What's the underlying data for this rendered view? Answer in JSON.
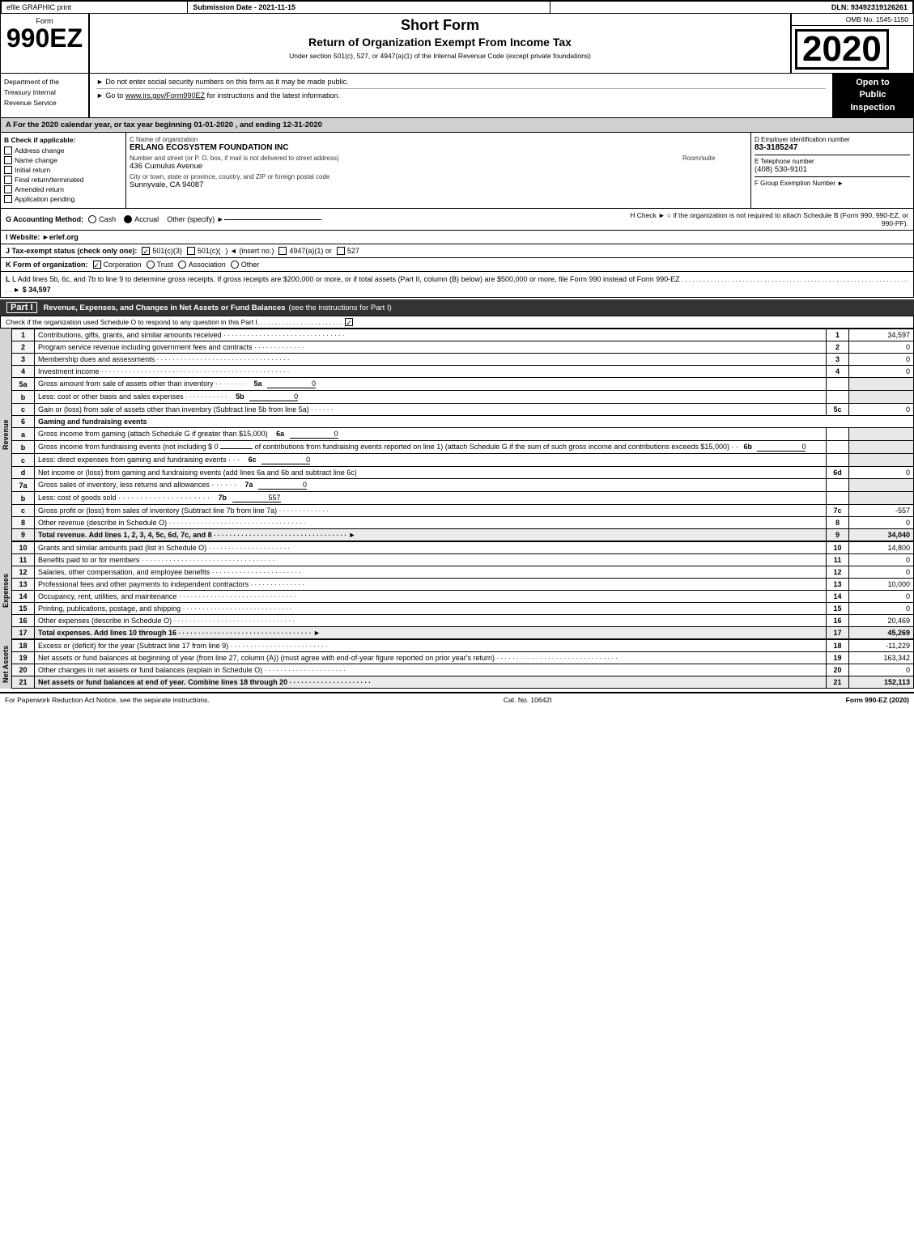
{
  "header": {
    "graphic_print": "efile GRAPHIC print",
    "submission_date_label": "Submission Date - 2021-11-15",
    "dln_label": "DLN: 93492319126261",
    "form_label": "Form",
    "form_number": "990EZ",
    "short_form": "Short Form",
    "return_title": "Return of Organization Exempt From Income Tax",
    "subtitle": "Under section 501(c), 527, or 4947(a)(1) of the Internal Revenue Code (except private foundations)",
    "do_not_enter": "► Do not enter social security numbers on this form as it may be made public.",
    "go_to": "► Go to www.irs.gov/Form990EZ for instructions and the latest information.",
    "year": "2020",
    "omb": "OMB No. 1545-1150",
    "open_to_public": "Open to\nPublic\nInspection"
  },
  "dept": {
    "name": "Department of the Treasury Internal Revenue Service"
  },
  "section_a": {
    "label": "A For the 2020 calendar year, or tax year beginning 01-01-2020 , and ending 12-31-2020"
  },
  "check_if": {
    "label": "B Check if applicable:",
    "items": [
      {
        "id": "address",
        "label": "Address change",
        "checked": false
      },
      {
        "id": "name",
        "label": "Name change",
        "checked": false
      },
      {
        "id": "initial",
        "label": "Initial return",
        "checked": false
      },
      {
        "id": "final",
        "label": "Final return/terminated",
        "checked": false
      },
      {
        "id": "amended",
        "label": "Amended return",
        "checked": false
      },
      {
        "id": "app_pending",
        "label": "Application pending",
        "checked": false
      }
    ]
  },
  "org": {
    "name_label": "C Name of organization",
    "name": "ERLANG ECOSYSTEM FOUNDATION INC",
    "address_label": "Number and street (or P. O. box, if mail is not delivered to street address)",
    "address": "436 Cumulus Avenue",
    "room_label": "Room/suite",
    "room": "",
    "city_label": "City or town, state or province, country, and ZIP or foreign postal code",
    "city": "Sunnyvale, CA 94087",
    "ein_label": "D Employer identification number",
    "ein": "83-3185247",
    "phone_label": "E Telephone number",
    "phone": "(408) 530-9101",
    "group_label": "F Group Exemption Number",
    "group_arrow": "►",
    "group_num": ""
  },
  "accounting": {
    "g_label": "G Accounting Method:",
    "cash_label": "Cash",
    "accrual_label": "Accrual",
    "accrual_checked": true,
    "other_label": "Other (specify) ►",
    "h_label": "H Check ► ○ if the organization is not required to attach Schedule B (Form 990, 990-EZ, or 990-PF)."
  },
  "website": {
    "i_label": "I Website: ►erlef.org"
  },
  "tax_exempt": {
    "j_label": "J Tax-exempt status (check only one):",
    "options": [
      {
        "label": "501(c)(3)",
        "checked": true
      },
      {
        "label": "501(c)(",
        "checked": false
      },
      {
        "label": ") ◄ (insert no.)",
        "checked": false
      },
      {
        "label": "4947(a)(1) or",
        "checked": false
      },
      {
        "label": "527",
        "checked": false
      }
    ]
  },
  "k_form": {
    "label": "K Form of organization:",
    "options": [
      {
        "label": "Corporation",
        "checked": true
      },
      {
        "label": "Trust",
        "checked": false
      },
      {
        "label": "Association",
        "checked": false
      },
      {
        "label": "Other",
        "checked": false
      }
    ]
  },
  "l_row": {
    "text": "L Add lines 5b, 6c, and 7b to line 9 to determine gross receipts. If gross receipts are $200,000 or more, or if total assets (Part II, column (B) below) are $500,000 or more, file Form 990 instead of Form 990-EZ",
    "dots": ". . . . . . . . . . . . . . . . . . . . . . . . . . . . . . . . . . . . . . . . . . . . . . . . . . . . . . . . . . . . . . . . .",
    "arrow": "►",
    "value": "$ 34,597"
  },
  "part1": {
    "label": "Part I",
    "title": "Revenue, Expenses, and Changes in Net Assets or Fund Balances",
    "see_instructions": "(see the instructions for Part I)",
    "check_text": "Check if the organization used Schedule O to respond to any question in this Part I",
    "dots": ". . . . . . . . . . . . . . . . . . . . . . . .",
    "check_box": true
  },
  "revenue_rows": [
    {
      "num": "1",
      "desc": "Contributions, gifts, grants, and similar amounts received",
      "dots": "· · · · · · · · · · · · · · · · · · · · · · · · · · · · · · ·",
      "line_num": "1",
      "value": "34,597"
    },
    {
      "num": "2",
      "desc": "Program service revenue including government fees and contracts",
      "dots": "· · · · · · · · · · · · ·",
      "line_num": "2",
      "value": "0"
    },
    {
      "num": "3",
      "desc": "Membership dues and assessments",
      "dots": "· · · · · · · · · · · · · · · · · · · · · · · · · · · · · · · · · ·",
      "line_num": "3",
      "value": "0"
    },
    {
      "num": "4",
      "desc": "Investment income",
      "dots": "· · · · · · · · · · · · · · · · · · · · · · · · · · · · · · · · · · · · · · · · · · · · · · · ·",
      "line_num": "4",
      "value": "0"
    }
  ],
  "row_5a": {
    "num": "5a",
    "desc": "Gross amount from sale of assets other than inventory",
    "dots": "· · · · · · · ·",
    "sub_line": "5a",
    "sub_value": "0"
  },
  "row_5b": {
    "letter": "b",
    "desc": "Less: cost or other basis and sales expenses",
    "dots": "· · · · · · · · · · ·",
    "sub_line": "5b",
    "sub_value": "0"
  },
  "row_5c": {
    "letter": "c",
    "desc": "Gain or (loss) from sale of assets other than inventory (Subtract line 5b from line 5a)",
    "dots": "· · · · · ·",
    "line_num": "5c",
    "value": "0"
  },
  "row_6": {
    "num": "6",
    "desc": "Gaming and fundraising events"
  },
  "row_6a": {
    "letter": "a",
    "desc": "Gross income from gaming (attach Schedule G if greater than $15,000)",
    "sub_line": "6a",
    "sub_value": "0"
  },
  "row_6b": {
    "letter": "b",
    "desc": "Gross income from fundraising events (not including $ 0 of contributions from fundraising events reported on line 1) (attach Schedule G if the sum of such gross income and contributions exceeds $15,000)",
    "dots": "· ·",
    "sub_line": "6b",
    "sub_value": "0"
  },
  "row_6c": {
    "letter": "c",
    "desc": "Less: direct expenses from gaming and fundraising events",
    "dots": "· · ·",
    "sub_line": "6c",
    "sub_value": "0"
  },
  "row_6d": {
    "letter": "d",
    "desc": "Net income or (loss) from gaming and fundraising events (add lines 6a and 6b and subtract line 6c)",
    "line_num": "6d",
    "value": "0"
  },
  "row_7a": {
    "num": "7a",
    "desc": "Gross sales of inventory, less returns and allowances",
    "dots": "· · · · · ·",
    "sub_line": "7a",
    "sub_value": "0"
  },
  "row_7b": {
    "letter": "b",
    "desc": "Less: cost of goods sold",
    "dots": "· · · · · · · · · · · · · · · · · · · · ·",
    "sub_line": "7b",
    "sub_value": "557"
  },
  "row_7c": {
    "letter": "c",
    "desc": "Gross profit or (loss) from sales of inventory (Subtract line 7b from line 7a)",
    "dots": "· · · · · · · · · · · · ·",
    "line_num": "7c",
    "value": "-557"
  },
  "row_8": {
    "num": "8",
    "desc": "Other revenue (describe in Schedule O)",
    "dots": "· · · · · · · · · · · · · · · · · · · · · · · · · · · · · · · · · · ·",
    "line_num": "8",
    "value": "0"
  },
  "row_9": {
    "num": "9",
    "desc": "Total revenue. Add lines 1, 2, 3, 4, 5c, 6d, 7c, and 8",
    "dots": "· · · · · · · · · · · · · · · · · · · · · · · · · · · · · · · · · ·",
    "arrow": "►",
    "line_num": "9",
    "value": "34,040",
    "bold": true
  },
  "expense_rows": [
    {
      "num": "10",
      "desc": "Grants and similar amounts paid (list in Schedule O)",
      "dots": "· · · · · · · · · · · · · · · · · · · · ·",
      "line_num": "10",
      "value": "14,800"
    },
    {
      "num": "11",
      "desc": "Benefits paid to or for members",
      "dots": "· · · · · · · · · · · · · · · · · · · · · · · · · · · · · · · · · ·",
      "line_num": "11",
      "value": "0"
    },
    {
      "num": "12",
      "desc": "Salaries, other compensation, and employee benefits",
      "dots": "· · · · · · · · · · · · · · · · · · · · · · ·",
      "line_num": "12",
      "value": "0"
    },
    {
      "num": "13",
      "desc": "Professional fees and other payments to independent contractors",
      "dots": "· · · · · · · · · · · · · ·",
      "line_num": "13",
      "value": "10,000"
    },
    {
      "num": "14",
      "desc": "Occupancy, rent, utilities, and maintenance",
      "dots": "· · · · · · · · · · · · · · · · · · · · · · · · · · · · · ·",
      "line_num": "14",
      "value": "0"
    },
    {
      "num": "15",
      "desc": "Printing, publications, postage, and shipping",
      "dots": "· · · · · · · · · · · · · · · · · · · · · · · · · · · ·",
      "line_num": "15",
      "value": "0"
    },
    {
      "num": "16",
      "desc": "Other expenses (describe in Schedule O)",
      "dots": "· · · · · · · · · · · · · · · · · · · · · · · · · · · · · · · ·",
      "line_num": "16",
      "value": "20,469"
    },
    {
      "num": "17",
      "desc": "Total expenses. Add lines 10 through 16",
      "dots": "· · · · · · · · · · · · · · · · · · · · · · · · · · · · · · · · · ·",
      "arrow": "►",
      "line_num": "17",
      "value": "45,269",
      "bold": true
    }
  ],
  "net_assets_rows": [
    {
      "num": "18",
      "desc": "Excess or (deficit) for the year (Subtract line 17 from line 9)",
      "dots": "· · · · · · · · · · · · · · · · · · · · · · · · ·",
      "line_num": "18",
      "value": "-11,229"
    },
    {
      "num": "19",
      "desc": "Net assets or fund balances at beginning of year (from line 27, column (A)) (must agree with end-of-year figure reported on prior year's return)",
      "dots": "· · · · · · · · · · · · · · · · · · · · · · · · · · · · · · ·",
      "line_num": "19",
      "value": "163,342"
    },
    {
      "num": "20",
      "desc": "Other changes in net assets or fund balances (explain in Schedule O)",
      "dots": "· · · · · · · · · · · · · · · · · · · · ·",
      "line_num": "20",
      "value": "0"
    },
    {
      "num": "21",
      "desc": "Net assets or fund balances at end of year. Combine lines 18 through 20",
      "dots": "· · · · · · · · · · · · · · · · · · · · ·",
      "line_num": "21",
      "value": "152,113",
      "bold": true
    }
  ],
  "footer": {
    "left": "For Paperwork Reduction Act Notice, see the separate instructions.",
    "middle": "Cat. No. 10642I",
    "right": "Form 990-EZ (2020)"
  }
}
